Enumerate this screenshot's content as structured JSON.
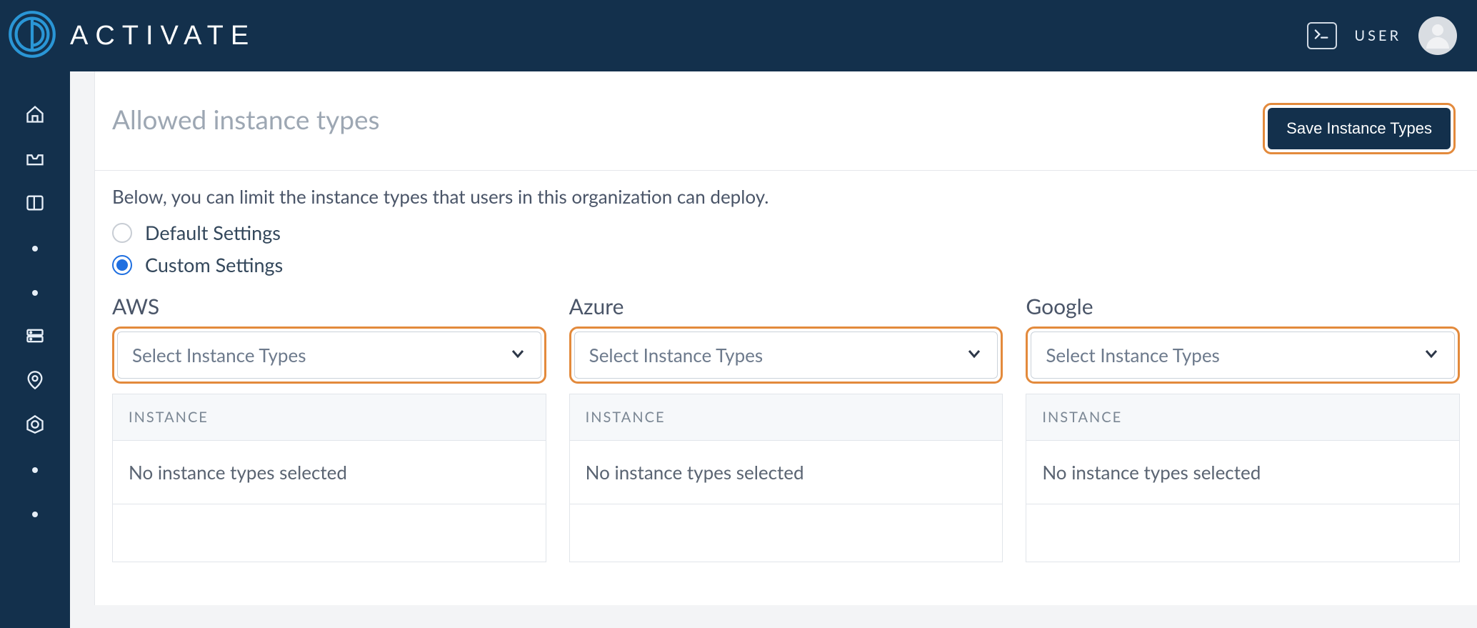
{
  "header": {
    "brand": "ACTIVATE",
    "user_label": "USER"
  },
  "section": {
    "title": "Allowed instance types",
    "save_button": "Save Instance Types",
    "description": "Below, you can limit the instance types that users in this organization can deploy."
  },
  "settings": {
    "default_label": "Default Settings",
    "custom_label": "Custom Settings",
    "selected": "custom"
  },
  "providers": {
    "aws": {
      "title": "AWS",
      "select_placeholder": "Select Instance Types",
      "table_header": "INSTANCE",
      "empty_text": "No instance types selected"
    },
    "azure": {
      "title": "Azure",
      "select_placeholder": "Select Instance Types",
      "table_header": "INSTANCE",
      "empty_text": "No instance types selected"
    },
    "google": {
      "title": "Google",
      "select_placeholder": "Select Instance Types",
      "table_header": "INSTANCE",
      "empty_text": "No instance types selected"
    }
  },
  "colors": {
    "header_bg": "#13304c",
    "accent_orange": "#e38a3c",
    "radio_blue": "#1f6fe0"
  }
}
